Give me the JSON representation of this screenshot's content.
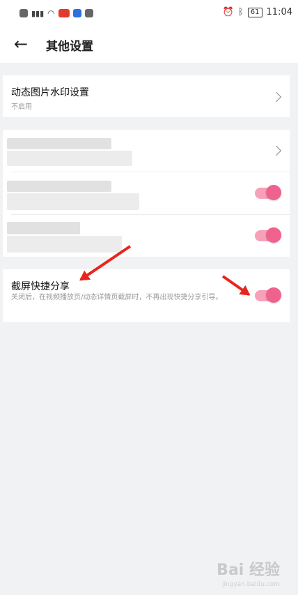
{
  "status_bar": {
    "indicators": [
      "hd-icon",
      "signal-icon",
      "wifi-icon",
      "app-icon-red",
      "app-icon-blue",
      "app-icon-dark"
    ],
    "right_icons": [
      "alarm-icon",
      "bluetooth-icon"
    ],
    "battery": "61",
    "time": "11:04"
  },
  "header": {
    "title": "其他设置"
  },
  "watermark_row": {
    "title": "动态图片水印设置",
    "subtitle": "不启用"
  },
  "screenshot_share": {
    "title": "截屏快捷分享",
    "description": "关闭后，在视频播放页/动态详情页截屏时，不再出现快捷分享引导。",
    "enabled": true
  },
  "blurred_rows": {
    "toggle_2_enabled": true,
    "toggle_3_enabled": true
  },
  "colors": {
    "accent": "#f0628e",
    "track": "#f7a0b8",
    "background": "#f1f2f4",
    "annotation": "#e8251c"
  },
  "watermark": {
    "logo": "Bai 经验",
    "sub": "jingyan.baidu.com"
  }
}
